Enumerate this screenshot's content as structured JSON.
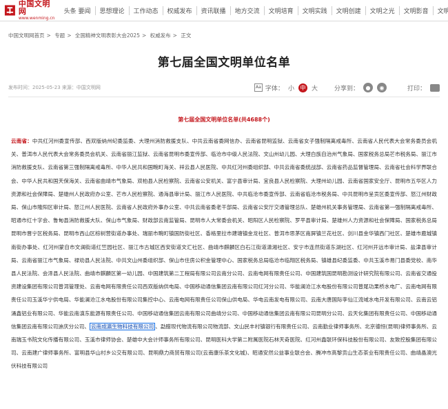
{
  "header": {
    "logo": {
      "name": "中国文明网",
      "url": "www.wenming.cn"
    },
    "nav": [
      "头条 要闻",
      "思想理论",
      "工作动态",
      "权威发布",
      "资讯联播",
      "地方交流",
      "文明培育",
      "文明实践",
      "文明创建",
      "文明之光",
      "文明影音",
      "文明矩阵"
    ]
  },
  "breadcrumb": [
    "中国文明网首页",
    "专题",
    "全国精神文明表彰大会2025",
    "权威发布",
    "正文"
  ],
  "breadcrumb_sep": ">",
  "article": {
    "title": "第七届全国文明单位名单",
    "meta": "发布时间：2025-05-23 来源：中国文明网",
    "font_label": "字体：",
    "font_options": [
      "小",
      "中",
      "大"
    ],
    "font_active": "中",
    "share_label": "分享到：",
    "print_label": "打印：",
    "subtitle": "第七届全国文明单位名单(共4688个)",
    "province": "云南省：",
    "text_before": "中共红河州委宣传部、西双版纳州纪委监委、大理州消防救援支队、中共云南省委网信办、云南省昆明监狱、云南省女子强制隔离戒毒所、云南省人民代表大会常务委员会机关、普洱市人民代表大会常务委员会机关、云南省丽江监狱、云南省昆明市委宣传部、临沧市中级人民法院、文山州幼儿园、大理白族自治州气象局、国家税务总局芒市税务局、丽江市消防救援支队、云南省第三强制隔离戒毒所、中华人民共和国畹町海关、祥云县人民医院、中共红河州委组织部、中共云南省委统战部、云南省药品监督管理局、云南省社会科学界联合会、中华人民共和国天保海关、云南省曲靖市气象局、双柏县人民检察院、云南省公安机关、富宁县审计局、宜良县人民检察院、大理州幼儿园、云南省国家安全厅、昆明市五华区人力资源和社会保障局、楚雄州人民政府办公室、芒市人民检察院、通海县审计局、丽江市人民医院、中共临沧市委宣传部、云南省临沧市税务局、中共昆明市呈贡区委宣传部、怒江州财政局、保山市隆阳区审计局、怒江州人民医院、云南省人民政府外事办公室、中共云南省委老干部局、云南省公安厅交通管理总队、楚雄州机关事务管理局、云南省第一强制隔离戒毒所、昭通市红十字会、鲁甸县消防救援大队、保山市气象局、财政部云南监管局、昆明市人大常委会机关、昭阳区人民检察院、罗平县审计局、楚雄州人力资源和社会保障局、国家税务总局昆明市晋宁区税务局、昆明市西山区棕树营街道办事处、瑞丽市畹町镇国防街社区、香格里拉市建塘镇金龙社区、普洱市思茅区南屏镇兰花社区、剑川县金华镇西门社区、楚雄市鹿城镇南街办事处、红河州蒙自市文澜街道红竺园社区、丽江市古城区西安街道文汇社区、曲靖市麒麟区白石江街道潇湘社区、安宁市连然街道东湖社区、红河州开远市审计局、盐津县审计局、云南省丽江市气象局、禄劝县人民法院、中共文山州委组织部、保山市住房公积金管理中心、国家税务总局临沧市临翔区税务局、镇雄县纪委监委、中共玉溪市易门县委党校、南华县人民法院、会泽县人民法院、曲靖市麒麟区第一幼儿园、中国建筑第二工程局有限公司云南分公司、云南电网有限责任公司、中国建筑国昆明勘测设计研究院有限公司、云南省交通投资建设集团有限公司普洱管理处、云南电网有限责任公司西双版纳供电局、中国移动通信集团云南有限公司红河分公司、华能澜沧江水电股份有限公司普尾功果桥水电厂、云南电网有限责任公司玉溪华宁供电局、华能澜沧江水电股份有限公司集控中心、云南电网有限责任公司保山供电局、华电云南发电有限公司、云南大唐国际李仙江流域水电开发有限公司、云南云铝涌鑫铝业有限公司、华能云南滇东能源有限责任公司、中国移动通信集团云南有限公司曲靖分公司、中国移动通信集团云南有限公司昆明分公司、云天化集团有限责任公司、中国移动通信集团云南有限公司迪庆分公司、",
    "highlighted": "云南成瀛生物科技有限公司",
    "text_after": "、勐腊现代物流有限公司物流部、文山民丰村镇银行有限责任公司、云南勤业律师事务所、北京德恒(昆明)律师事务所、云南瑞玉书院文化传播有限公司、玉溪市律师协会、楚雄中大会计师事务所有限公司、昆明医科大学第二附属医院石林天奇医院、红河州鑫联环保科技股份有限公司、友致控股集团有限公司、云南建广律师事务所、富明县华山村乡公交有限公司、昆明鼎力商贸有限公司(云南康乐茶文化城)、昭通安然公益事业联合会、腾冲市高黎贡山生态茶业有限责任公司、曲靖晶澳光伏科技有限公司"
  },
  "colors": {
    "brand_red": "#c4161c",
    "highlight_blue": "#1a73e8"
  },
  "icons": {
    "wechat": "wechat-icon",
    "weibo": "weibo-icon",
    "print": "print-icon",
    "font": "font-size-icon"
  }
}
